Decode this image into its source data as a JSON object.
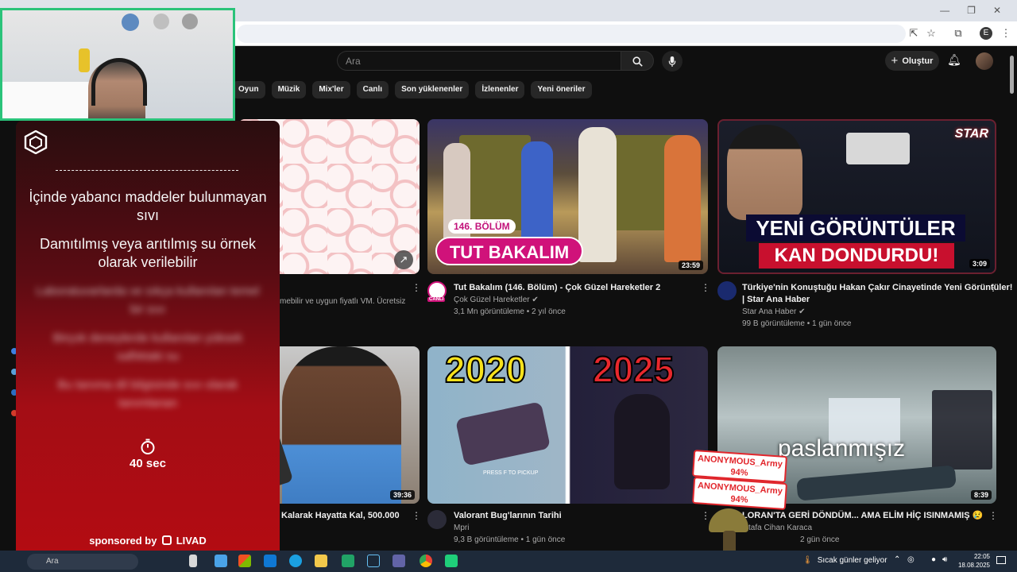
{
  "search": {
    "placeholder": "Ara"
  },
  "header": {
    "create_label": "Oluştur",
    "profile_initial": "E"
  },
  "chips": [
    "Oyun",
    "Müzik",
    "Mix'ler",
    "Canlı",
    "Son yüklenenler",
    "İzlenenler",
    "Yeni öneriler"
  ],
  "videos": [
    {
      "desc_partial": "mebilir ve uygun fiyatlı VM. Ücretsiz"
    },
    {
      "overlay_badge": "146. BÖLÜM",
      "overlay_title": "TUT BAKALIM",
      "duration": "23:59",
      "title": "Tut Bakalım (146. Bölüm) - Çok Güzel Hareketler 2",
      "channel": "Çok Güzel Hareketler",
      "live_badge": "CANLI",
      "meta": "3,1 Mn görüntüleme • 2 yıl önce"
    },
    {
      "overlay_line1": "YENİ GÖRÜNTÜLER",
      "overlay_line2": "KAN DONDURDU!",
      "logo": "STAR",
      "duration": "3:09",
      "title_line1": "Türkiye'nin Konuştuğu Hakan Çakır Cinayetinde Yeni Görüntüler!",
      "title_line2": "| Star Ana Haber",
      "channel": "Star Ana Haber",
      "meta": "99 B görüntüleme • 1 gün önce"
    },
    {
      "duration": "39:36",
      "title_partial": "Kalarak Hayatta Kal, 500.000"
    },
    {
      "overlay_left": "2020",
      "overlay_right": "2025",
      "duration": "8",
      "title": "Valorant Bug'larının Tarihi",
      "channel": "Mpri",
      "meta": "9,3 B görüntüleme • 1 gün önce",
      "pickup_text": "PRESS F TO PICKUP"
    },
    {
      "overlay_text": "paslanmışız",
      "duration": "8:39",
      "title_partial": "LORAN'TA GERİ DÖNDÜM... AMA ELİM HİÇ ISINMAMIŞ 😢",
      "channel_partial": "tafa Cihan Karaca",
      "meta_partial": "2 gün önce"
    }
  ],
  "quiz": {
    "question": "İçinde yabancı maddeler bulunmayan sıvı",
    "answer": "Damıtılmış veya arıtılmış su örnek olarak verilebilir",
    "blurred_1": "Laboratuvarlarda ve sıkça kullanılan temel bir sıvı",
    "blurred_2": "Birçok deneylerde kullanılan yüksek saflıktaki su",
    "blurred_3": "Bu tanıma dil bilgisinde sıvı olarak tanımlanan",
    "timer": "40 sec",
    "sponsor": "sponsored by",
    "sponsor_brand": "LIVAD"
  },
  "stream_badges": [
    {
      "name": "ANONYMOUS_Army",
      "pct": "94%"
    },
    {
      "name": "ANONYMOUS_Army",
      "pct": "94%"
    }
  ],
  "taskbar": {
    "search_label": "Ara",
    "weather": "Sıcak günler geliyor",
    "time": "22:05",
    "date": "18.08.2025"
  },
  "colors": {
    "accent": "#2ac37a",
    "quiz_red": "#b40c12",
    "youtube_bg": "#0f0f0f"
  }
}
